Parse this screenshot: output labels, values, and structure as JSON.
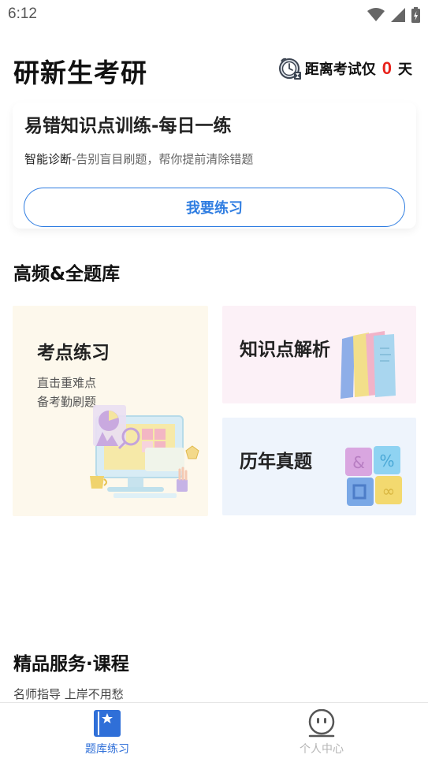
{
  "status_bar": {
    "time": "6:12"
  },
  "header": {
    "title": "研新生考研",
    "countdown_label": "距离考试仅",
    "countdown_value": "0",
    "countdown_unit": "天"
  },
  "daily_practice": {
    "title": "易错知识点训练-每日一练",
    "desc_strong": "智能诊断",
    "desc_rest": "-告别盲目刷题，帮你提前清除错题",
    "button_label": "我要练习"
  },
  "question_bank": {
    "title": "高频&全题库",
    "tiles": [
      {
        "title": "考点练习",
        "subtitle_lines": [
          "直击重难点",
          "备考勤刷题"
        ]
      },
      {
        "title": "知识点解析"
      },
      {
        "title": "历年真题"
      }
    ]
  },
  "services": {
    "title": "精品服务·课程",
    "subtitle": "名师指导 上岸不用愁"
  },
  "bottom_nav": {
    "items": [
      {
        "label": "题库练习",
        "icon": "bookmark-book-icon",
        "active": true
      },
      {
        "label": "个人中心",
        "icon": "smiley-face-icon",
        "active": false
      }
    ]
  },
  "colors": {
    "accent": "#2f7de1",
    "countdown": "#e8221b",
    "nav_active": "#2f6fd8",
    "nav_inactive": "#b5b5b5"
  }
}
